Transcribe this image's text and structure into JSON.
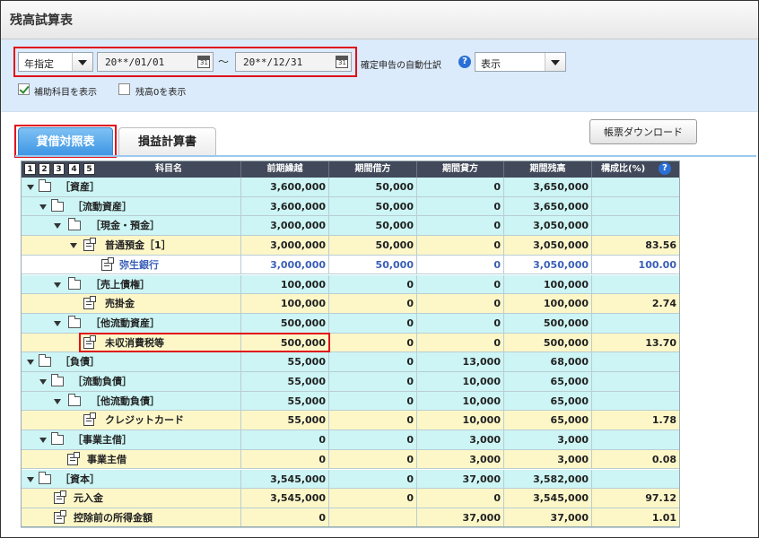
{
  "title": "残高試算表",
  "filter": {
    "period_type": "年指定",
    "date_from": "20**/01/01",
    "tilde": "～",
    "date_to": "20**/12/31",
    "auto_label": "確定申告の自動仕訳",
    "auto_value": "表示",
    "help_glyph": "?",
    "chk1_label": "補助科目を表示",
    "chk2_label": "残高0を表示"
  },
  "tabs": {
    "balance_sheet": "貸借対照表",
    "pl": "損益計算書"
  },
  "download_label": "帳票ダウンロード",
  "table": {
    "levels": [
      "1",
      "2",
      "3",
      "4",
      "5"
    ],
    "headers": [
      "科目名",
      "前期繰越",
      "期間借方",
      "期間貸方",
      "期間残高",
      "構成比(%)"
    ],
    "rows": [
      {
        "name": "［資産］",
        "c": [
          "3,600,000",
          "50,000",
          "0",
          "3,650,000",
          ""
        ]
      },
      {
        "name": "［流動資産］",
        "c": [
          "3,600,000",
          "50,000",
          "0",
          "3,650,000",
          ""
        ]
      },
      {
        "name": "［現金・預金］",
        "c": [
          "3,000,000",
          "50,000",
          "0",
          "3,050,000",
          ""
        ]
      },
      {
        "name": "普通預金［1］",
        "c": [
          "3,000,000",
          "50,000",
          "0",
          "3,050,000",
          "83.56"
        ]
      },
      {
        "name": "弥生銀行",
        "c": [
          "3,000,000",
          "50,000",
          "0",
          "3,050,000",
          "100.00"
        ]
      },
      {
        "name": "［売上債権］",
        "c": [
          "100,000",
          "0",
          "0",
          "100,000",
          ""
        ]
      },
      {
        "name": "売掛金",
        "c": [
          "100,000",
          "0",
          "0",
          "100,000",
          "2.74"
        ]
      },
      {
        "name": "［他流動資産］",
        "c": [
          "500,000",
          "0",
          "0",
          "500,000",
          ""
        ]
      },
      {
        "name": "未収消費税等",
        "c": [
          "500,000",
          "0",
          "0",
          "500,000",
          "13.70"
        ]
      },
      {
        "name": "［負債］",
        "c": [
          "55,000",
          "0",
          "13,000",
          "68,000",
          ""
        ]
      },
      {
        "name": "［流動負債］",
        "c": [
          "55,000",
          "0",
          "10,000",
          "65,000",
          ""
        ]
      },
      {
        "name": "［他流動負債］",
        "c": [
          "55,000",
          "0",
          "10,000",
          "65,000",
          ""
        ]
      },
      {
        "name": "クレジットカード",
        "c": [
          "55,000",
          "0",
          "10,000",
          "65,000",
          "1.78"
        ]
      },
      {
        "name": "［事業主借］",
        "c": [
          "0",
          "0",
          "3,000",
          "3,000",
          ""
        ]
      },
      {
        "name": "事業主借",
        "c": [
          "0",
          "0",
          "3,000",
          "3,000",
          "0.08"
        ]
      },
      {
        "name": "［資本］",
        "c": [
          "3,545,000",
          "0",
          "37,000",
          "3,582,000",
          ""
        ]
      },
      {
        "name": "元入金",
        "c": [
          "3,545,000",
          "0",
          "0",
          "3,545,000",
          "97.12"
        ]
      },
      {
        "name": "控除前の所得金額",
        "c": [
          "0",
          "",
          "37,000",
          "37,000",
          "1.01"
        ]
      }
    ]
  }
}
